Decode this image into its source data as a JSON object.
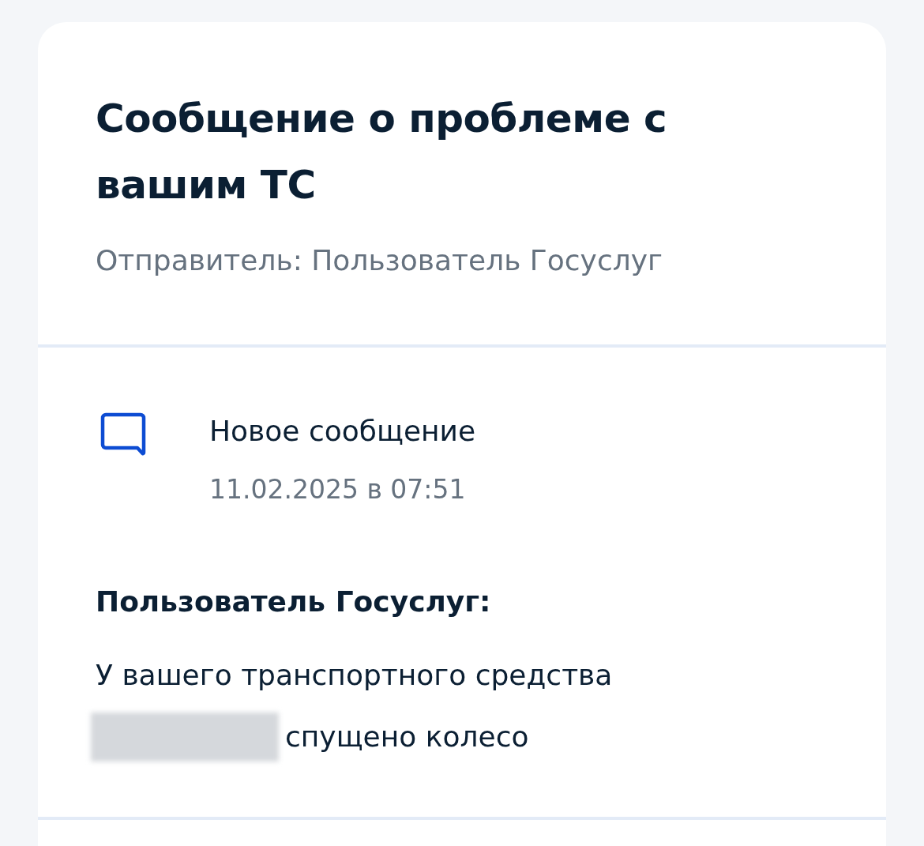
{
  "header": {
    "title": "Сообщение о проблеме с вашим ТС",
    "sender": "Отправитель: Пользователь Госуслуг"
  },
  "event": {
    "title": "Новое сообщение",
    "date": "11.02.2025 в 07:51"
  },
  "message": {
    "author": "Пользователь Госуслуг:",
    "text_line_1": "У вашего транспортного средства",
    "text_line_2": "спущено колесо"
  }
}
